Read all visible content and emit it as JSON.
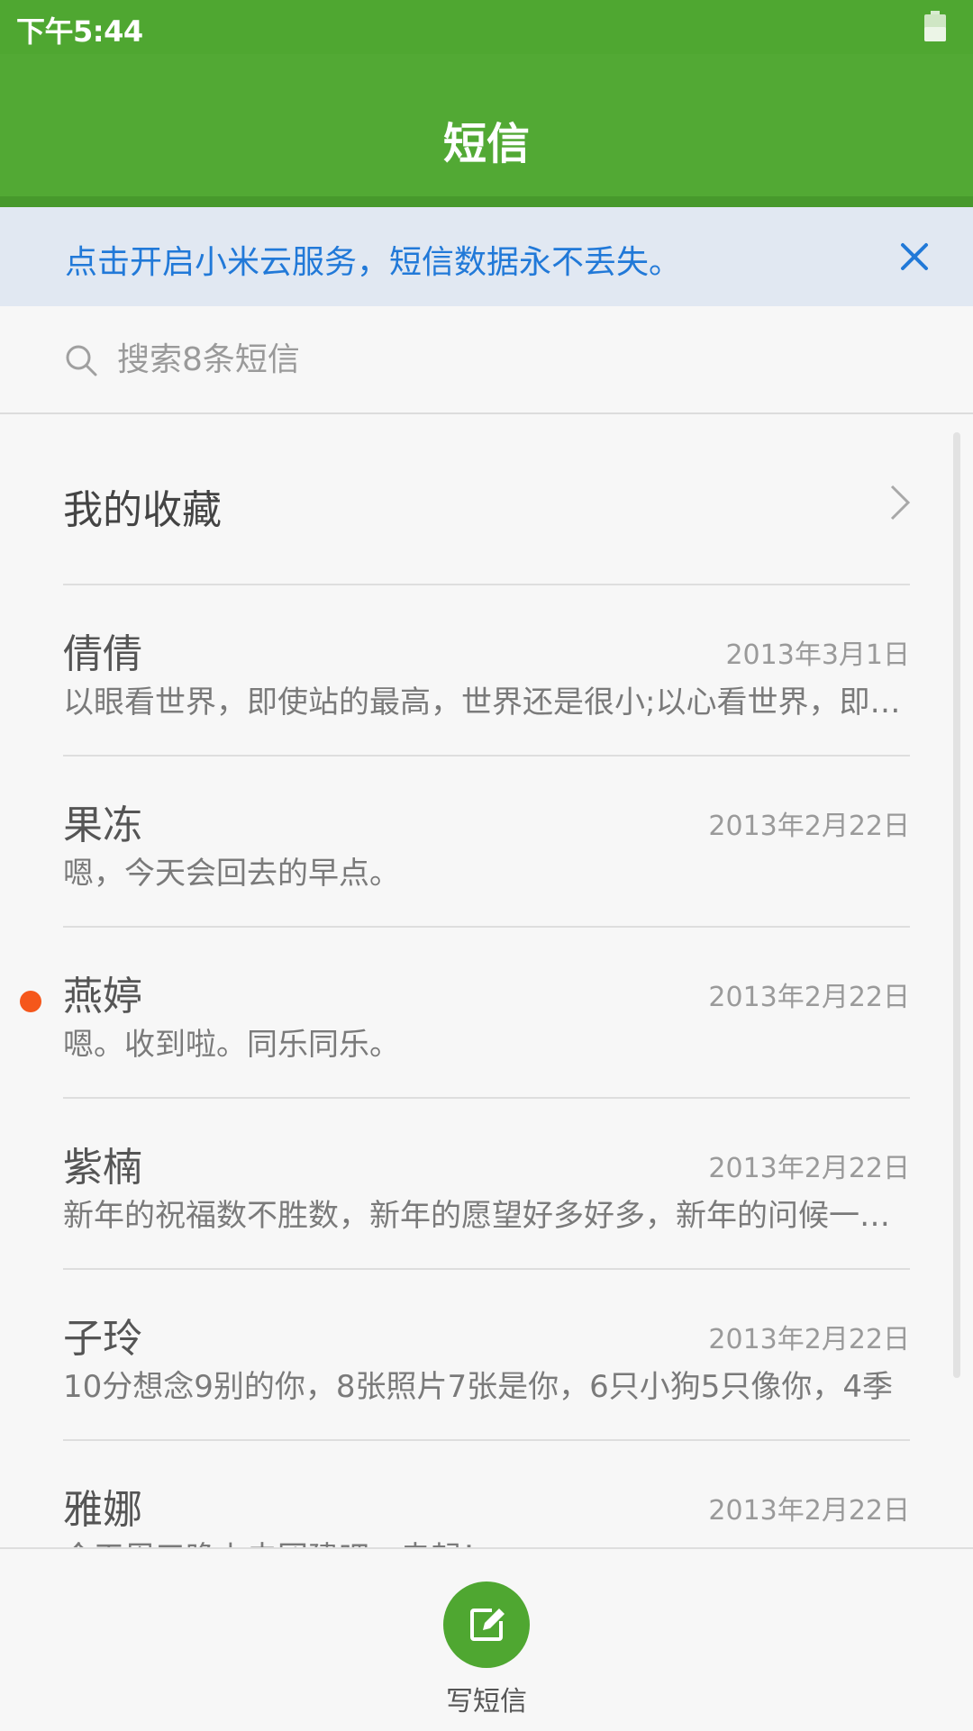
{
  "status_bar": {
    "time": "下午5:44"
  },
  "header": {
    "title": "短信"
  },
  "banner": {
    "text": "点击开启小米云服务，短信数据永不丢失。"
  },
  "search": {
    "placeholder": "搜索8条短信"
  },
  "favorites": {
    "label": "我的收藏"
  },
  "conversations": [
    {
      "name": "倩倩",
      "date": "2013年3月1日",
      "preview": "以眼看世界，即使站的最高，世界还是很小;以心看世界，即使站的最低，世界也是很大",
      "unread": false
    },
    {
      "name": "果冻",
      "date": "2013年2月22日",
      "preview": "嗯，今天会回去的早点。",
      "unread": false
    },
    {
      "name": "燕婷",
      "date": "2013年2月22日",
      "preview": "嗯。收到啦。同乐同乐。",
      "unread": true
    },
    {
      "name": "紫楠",
      "date": "2013年2月22日",
      "preview": "新年的祝福数不胜数，新年的愿望好多好多，新年的问候一句一句",
      "unread": false
    },
    {
      "name": "子玲",
      "date": "2013年2月22日",
      "preview": "10分想念9别的你，8张照片7张是你，6只小狗5只像你，4季",
      "unread": false
    },
    {
      "name": "雅娜",
      "date": "2013年2月22日",
      "preview": "今天周五晚上去团建吧，走起！",
      "unread": false
    }
  ],
  "bottom_bar": {
    "compose_label": "写短信"
  },
  "colors": {
    "accent": "#4fa731",
    "banner_text": "#2179d8",
    "unread_dot": "#f5571b"
  }
}
